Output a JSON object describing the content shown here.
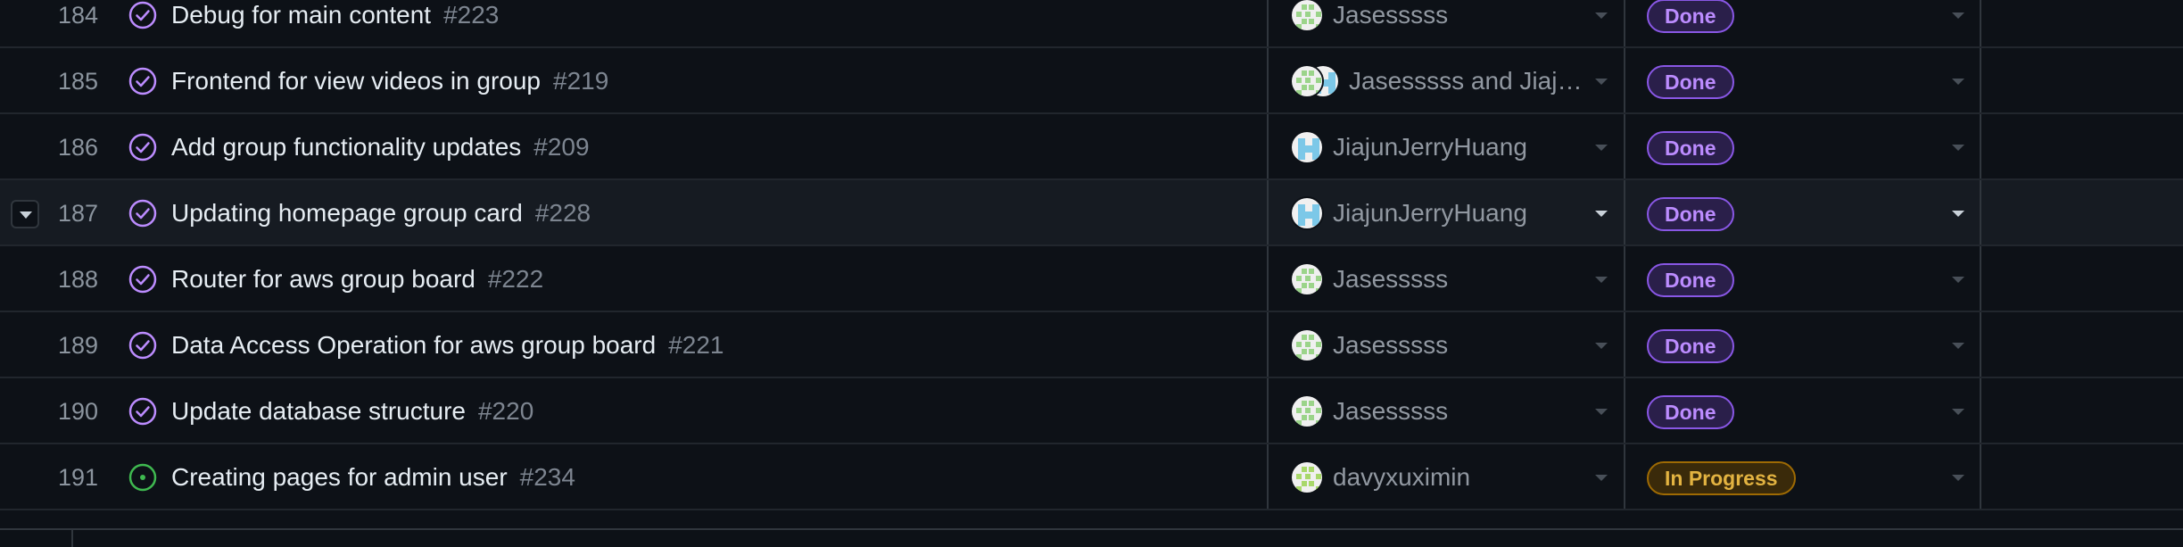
{
  "colors": {
    "background": "#0d1117",
    "row_border": "#21262d",
    "done_purple": "#bc8cff",
    "in_progress_yellow": "#e3b341",
    "open_green": "#3fb950"
  },
  "rows": [
    {
      "num": "184",
      "title": "Debug for main content",
      "issue": "#223",
      "status_icon": "closed-circle-check-icon",
      "assignee": "Jasesssss",
      "avatars": [
        "green"
      ],
      "status": "Done"
    },
    {
      "num": "185",
      "title": "Frontend for view videos in group",
      "issue": "#219",
      "status_icon": "closed-circle-check-icon",
      "assignee": "Jasesssss and Jiajun…",
      "avatars": [
        "green",
        "blue"
      ],
      "status": "Done"
    },
    {
      "num": "186",
      "title": "Add group functionality updates",
      "issue": "#209",
      "status_icon": "closed-circle-check-icon",
      "assignee": "JiajunJerryHuang",
      "avatars": [
        "blue"
      ],
      "status": "Done"
    },
    {
      "num": "187",
      "title": "Updating homepage group card",
      "issue": "#228",
      "status_icon": "closed-circle-check-icon",
      "assignee": "JiajunJerryHuang",
      "avatars": [
        "blue"
      ],
      "status": "Done",
      "hover": true
    },
    {
      "num": "188",
      "title": "Router for aws group board",
      "issue": "#222",
      "status_icon": "closed-circle-check-icon",
      "assignee": "Jasesssss",
      "avatars": [
        "green"
      ],
      "status": "Done"
    },
    {
      "num": "189",
      "title": "Data Access Operation for aws group board",
      "issue": "#221",
      "status_icon": "closed-circle-check-icon",
      "assignee": "Jasesssss",
      "avatars": [
        "green"
      ],
      "status": "Done"
    },
    {
      "num": "190",
      "title": "Update database structure",
      "issue": "#220",
      "status_icon": "closed-circle-check-icon",
      "assignee": "Jasesssss",
      "avatars": [
        "green"
      ],
      "status": "Done"
    },
    {
      "num": "191",
      "title": "Creating pages for admin user",
      "issue": "#234",
      "status_icon": "open-issue-icon",
      "assignee": "davyxuximin",
      "avatars": [
        "lime"
      ],
      "status": "In Progress"
    }
  ]
}
